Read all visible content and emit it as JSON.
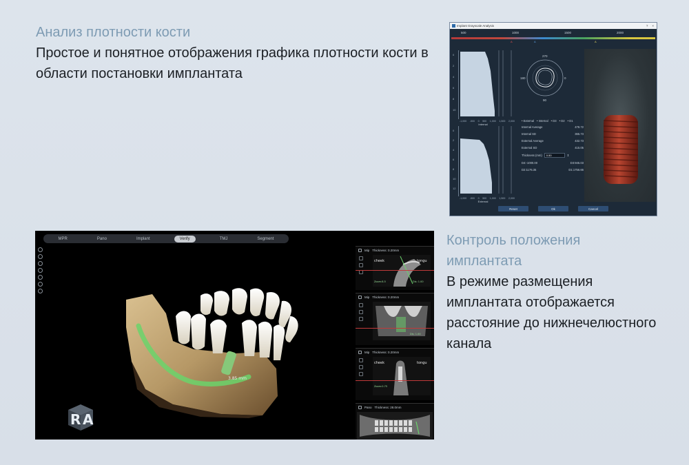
{
  "section1": {
    "heading": "Анализ плотности кости",
    "body": "Простое и понятное отображения графика плотности кости в области постановки имплантата"
  },
  "section2": {
    "heading": "Контроль положения имплантата",
    "body": "В режиме размещения имплантата отображается расстояние до нижнечелюстного канала"
  },
  "grayscale_window": {
    "title": "Implant Grayscale Analysis",
    "window_controls": [
      "?",
      "×"
    ],
    "scale_labels": [
      "500",
      "1000",
      "1500",
      "2000"
    ],
    "bar_markers": [
      "A",
      "A",
      "A"
    ],
    "plot_internal": {
      "xlabel": "Internal",
      "x_ticks": [
        "-1,000",
        "-500",
        "0",
        "500",
        "1,000",
        "1,500",
        "2,000"
      ],
      "y_ticks": [
        "0",
        "2",
        "4",
        "6",
        "8",
        "10"
      ]
    },
    "plot_external": {
      "xlabel": "External",
      "x_ticks": [
        "-1,000",
        "-500",
        "0",
        "500",
        "1,000",
        "1,500",
        "2,000"
      ],
      "y_ticks": [
        "0",
        "2",
        "4",
        "6",
        "8",
        "10",
        "12"
      ]
    },
    "polar_labels": {
      "top": "270",
      "left": "180",
      "right": "0",
      "bottom": "90"
    },
    "legend": [
      "External",
      "Internal",
      "D3",
      "D2",
      "D1"
    ],
    "stats": [
      {
        "label": "Internal Average",
        "value": "478.72"
      },
      {
        "label": "Internal SD",
        "value": "365.73"
      },
      {
        "label": "External Average",
        "value": "432.73"
      },
      {
        "label": "External SD",
        "value": "415.05"
      }
    ],
    "thickness_label": "Thickness (mm)",
    "thickness_value": "0.50",
    "density_rows": [
      {
        "left": "D4:-1000.00",
        "right": "D3:945.03"
      },
      {
        "left": "D2:1176.35",
        "right": "D1:1756.66"
      }
    ],
    "buttons": {
      "reset": "Reset",
      "ok": "Ok",
      "cancel": "Cancel"
    }
  },
  "verify_window": {
    "tabs": [
      "MPR",
      "Pano",
      "Implant",
      "Verify",
      "TMJ",
      "Segment"
    ],
    "active_tab": "Verify",
    "measurement": "3.85 mm",
    "cube_letters": [
      "R",
      "A"
    ],
    "viewports": [
      {
        "mode": "Mip",
        "thickness": "Thickness: 0.20mm",
        "left_label": "cheek",
        "right_label": "tongu",
        "zoom": "Zoom:8.5",
        "extra": "Dis: 1.00"
      },
      {
        "mode": "Mip",
        "thickness": "Thickness: 0.20mm",
        "left_label": "",
        "right_label": "",
        "zoom": "",
        "extra": "Dis: 1.00"
      },
      {
        "mode": "Mip",
        "thickness": "Thickness: 0.20mm",
        "left_label": "cheek",
        "right_label": "tongu",
        "zoom": "Zoom:0.75",
        "extra": ""
      },
      {
        "mode": "Pano",
        "thickness": "Thickness: 28.0mm",
        "left_label": "",
        "right_label": "",
        "zoom": "",
        "extra": ""
      }
    ]
  },
  "colors": {
    "heading": "#7d9bb3",
    "body_text": "#1b1f24",
    "background": "#dde4ec",
    "implant": "#a8382a",
    "canal": "#6bd36b"
  }
}
